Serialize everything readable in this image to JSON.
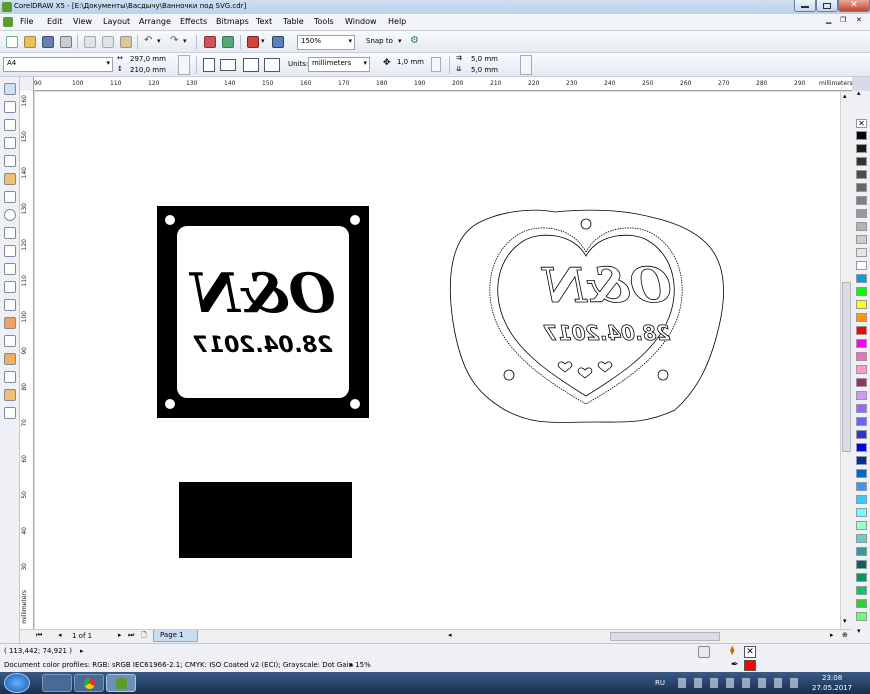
{
  "window": {
    "title": "CorelDRAW X5 - [E:\\Документы\\Васдычу\\Ванночки под SVG.cdr]"
  },
  "menu": [
    "File",
    "Edit",
    "View",
    "Layout",
    "Arrange",
    "Effects",
    "Bitmaps",
    "Text",
    "Table",
    "Tools",
    "Window",
    "Help"
  ],
  "toolbar": {
    "zoom": "150%",
    "snap_label": "Snap to"
  },
  "property_bar": {
    "page_size": "A4",
    "width": "297,0 mm",
    "height": "210,0 mm",
    "units_label": "Units:",
    "units_value": "millimeters",
    "nudge": "1,0 mm",
    "dup_x": "5,0 mm",
    "dup_y": "5,0 mm"
  },
  "ruler": {
    "h_ticks": [
      "90",
      "100",
      "110",
      "120",
      "130",
      "140",
      "150",
      "160",
      "170",
      "180",
      "190",
      "200",
      "210",
      "220",
      "230",
      "240",
      "250",
      "260",
      "270",
      "280",
      "290"
    ],
    "h_unit": "millimeters",
    "v_ticks": [
      "160",
      "150",
      "140",
      "130",
      "120",
      "110",
      "100",
      "90",
      "80",
      "70",
      "60",
      "50",
      "40",
      "30"
    ],
    "v_unit": "millimeters"
  },
  "artwork": {
    "monogram": "O&N",
    "date": "28.04.2017"
  },
  "page_nav": {
    "counter": "1 of 1",
    "tab": "Page 1"
  },
  "status": {
    "coords": "( 113,442; 74,921 )",
    "profiles": "Document color profiles: RGB: sRGB IEC61966-2.1; CMYK: ISO Coated v2 (ECI); Grayscale: Dot Gain 15%"
  },
  "taskbar": {
    "lang": "RU",
    "time": "23:08",
    "date": "27.05.2017"
  },
  "palette": [
    "#000000",
    "#1a1a1a",
    "#333333",
    "#4d4d4d",
    "#666666",
    "#808080",
    "#999999",
    "#b3b3b3",
    "#cccccc",
    "#e6e6e6",
    "#ffffff",
    "#00a0e9",
    "#00ff00",
    "#ffff00",
    "#ff9900",
    "#ff0000",
    "#ff00ff",
    "#ff66cc",
    "#ff99cc",
    "#993366",
    "#cc99ff",
    "#9966ff",
    "#6666ff",
    "#3333cc",
    "#0000ff",
    "#003399",
    "#0066cc",
    "#3399ff",
    "#33ccff",
    "#66ffff",
    "#99ffcc",
    "#66cccc",
    "#339999",
    "#006666",
    "#009966",
    "#00cc66",
    "#33cc33",
    "#66ff66"
  ],
  "colors": {
    "titlebar": "#c5d8ee",
    "accent": "#3a5a86",
    "fill_swatch": "#ff0000"
  }
}
